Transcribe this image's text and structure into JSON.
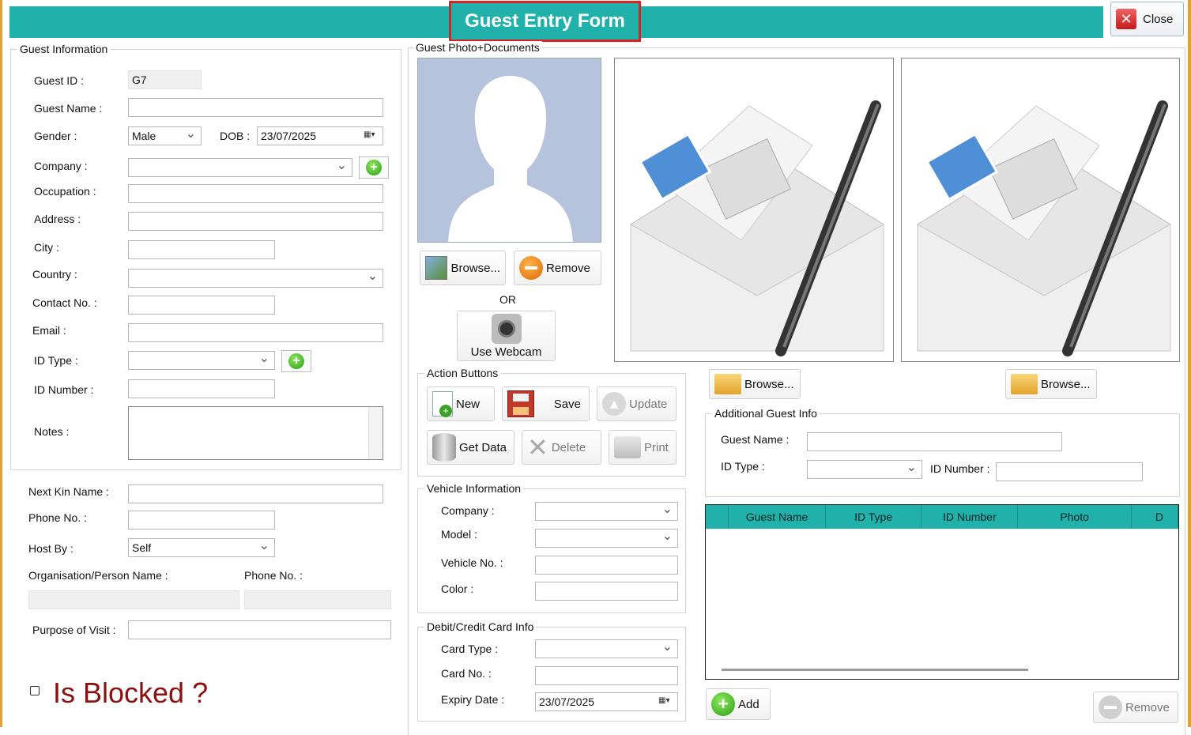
{
  "window": {
    "title": "Guest Entry Form",
    "close_label": "Close"
  },
  "guest_info": {
    "group_title": "Guest Information",
    "guest_id_label": "Guest ID :",
    "guest_id_value": "G7",
    "guest_name_label": "Guest Name :",
    "gender_label": "Gender :",
    "gender_value": "Male",
    "dob_label": "DOB :",
    "dob_value": "23/07/2025",
    "company_label": "Company :",
    "occupation_label": "Occupation :",
    "address_label": "Address :",
    "city_label": "City :",
    "country_label": "Country :",
    "contact_label": "Contact No. :",
    "email_label": "Email :",
    "id_type_label": "ID Type :",
    "id_number_label": "ID Number :",
    "notes_label": "Notes :"
  },
  "kin": {
    "next_kin_label": "Next Kin Name :",
    "phone_label": "Phone No. :",
    "host_by_label": "Host By :",
    "host_by_value": "Self",
    "org_label": "Organisation/Person Name :",
    "org_phone_label": "Phone No. :",
    "purpose_label": "Purpose of Visit :",
    "blocked_label": "Is Blocked ?"
  },
  "photo": {
    "group_title": "Guest Photo+Documents",
    "browse_label": "Browse...",
    "remove_label": "Remove",
    "or_label": "OR",
    "webcam_label": "Use Webcam",
    "doc_browse_1": "Browse...",
    "doc_browse_2": "Browse..."
  },
  "actions": {
    "group_title": "Action Buttons",
    "new_label": "New",
    "save_label": "Save",
    "update_label": "Update",
    "getdata_label": "Get Data",
    "delete_label": "Delete",
    "print_label": "Print"
  },
  "vehicle": {
    "group_title": "Vehicle Information",
    "company_label": "Company :",
    "model_label": "Model :",
    "vehicle_no_label": "Vehicle No. :",
    "color_label": "Color :"
  },
  "card": {
    "group_title": "Debit/Credit Card Info",
    "card_type_label": "Card Type :",
    "card_no_label": "Card No. :",
    "expiry_label": "Expiry Date :",
    "expiry_value": "23/07/2025"
  },
  "additional": {
    "group_title": "Additional Guest Info",
    "guest_name_label": "Guest Name :",
    "id_type_label": "ID Type :",
    "id_number_label": "ID Number :",
    "columns": [
      "Guest Name",
      "ID Type",
      "ID Number",
      "Photo",
      "D"
    ],
    "add_label": "Add",
    "remove_label": "Remove"
  },
  "colors": {
    "accent": "#20b2aa",
    "title_border": "#e0201f",
    "blocked_text": "#8b1010"
  }
}
